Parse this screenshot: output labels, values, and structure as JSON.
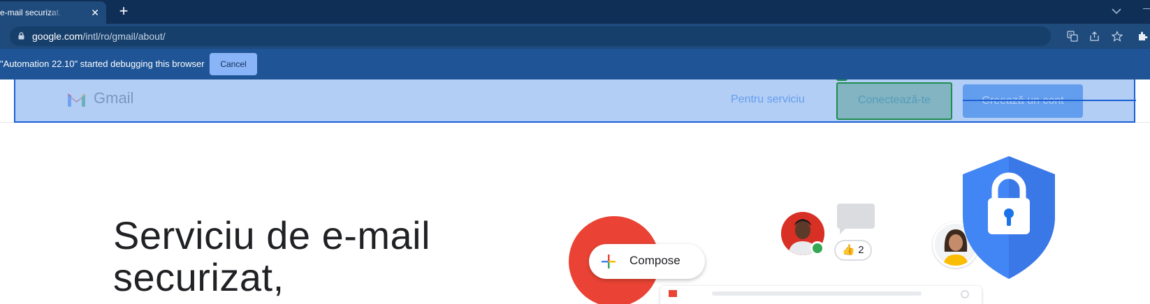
{
  "browser": {
    "tab": {
      "title": "Gmail: e-mail securizat, privat și gratuit",
      "close_label": "✕"
    },
    "new_tab_label": "+",
    "address": {
      "host": "google.com",
      "path": "/intl/ro/gmail/about/"
    },
    "toolbar_icons": [
      "translate-icon",
      "share-icon",
      "star-icon",
      "extensions-icon"
    ],
    "infobar": {
      "message": "\"Automation 22.10\" started debugging this browser",
      "cancel_label": "Cancel"
    }
  },
  "site": {
    "logo_text": "Gmail",
    "nav": {
      "business_label": "Pentru serviciu",
      "signin_label": "Conectează-te",
      "create_account_label": "Creează un cont"
    },
    "hero": {
      "title_line1": "Serviciu de e-mail",
      "title_line2": "securizat,"
    },
    "illustration": {
      "compose_label": "Compose",
      "like_count": "2",
      "like_emoji": "👍"
    }
  },
  "colors": {
    "brand_blue": "#1a73e8",
    "gmail_red": "#ea4335",
    "green": "#34a853",
    "yellow": "#fbbc04"
  }
}
